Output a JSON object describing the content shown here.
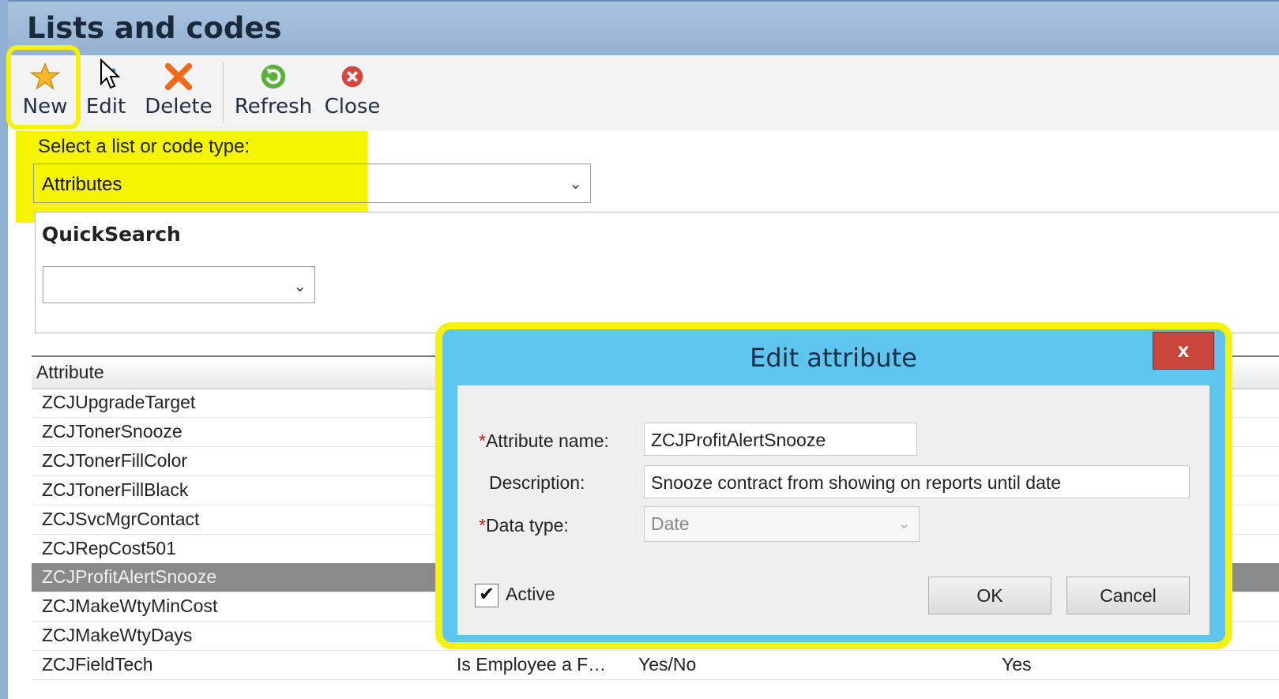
{
  "window": {
    "title": "Lists and codes"
  },
  "toolbar": {
    "new_label": "New",
    "edit_label": "Edit",
    "delete_label": "Delete",
    "refresh_label": "Refresh",
    "close_label": "Close"
  },
  "list_type": {
    "label": "Select a list or code type:",
    "value": "Attributes"
  },
  "quicksearch": {
    "label": "QuickSearch",
    "value": ""
  },
  "grid": {
    "column_attribute": "Attribute",
    "rows": [
      {
        "attribute": "ZCJUpgradeTarget"
      },
      {
        "attribute": "ZCJTonerSnooze"
      },
      {
        "attribute": "ZCJTonerFillColor"
      },
      {
        "attribute": "ZCJTonerFillBlack"
      },
      {
        "attribute": "ZCJSvcMgrContact"
      },
      {
        "attribute": "ZCJRepCost501"
      },
      {
        "attribute": "ZCJProfitAlertSnooze",
        "selected": true
      },
      {
        "attribute": "ZCJMakeWtyMinCost"
      },
      {
        "attribute": "ZCJMakeWtyDays"
      },
      {
        "attribute": "ZCJFieldTech",
        "description": "Is Employee a F…",
        "data_type": "Yes/No",
        "active": "Yes"
      }
    ]
  },
  "dialog": {
    "title": "Edit attribute",
    "close_glyph": "x",
    "required_mark": "*",
    "name_label": "Attribute name:",
    "name_value": "ZCJProfitAlertSnooze",
    "description_label": "Description:",
    "description_value": "Snooze contract from showing on reports until date",
    "datatype_label": "Data type:",
    "datatype_value": "Date",
    "active_label": "Active",
    "active_checked": true,
    "ok_label": "OK",
    "cancel_label": "Cancel"
  },
  "colors": {
    "highlight": "#f5f10a",
    "dialog_frame": "#5ec6ee",
    "title_bar": "#a9c3de",
    "close_button": "#c9463d",
    "required": "#c41d1d"
  },
  "icons": {
    "new": "star-icon",
    "edit": "cursor-icon",
    "delete": "x-icon",
    "refresh": "refresh-icon",
    "close": "close-circle-icon"
  }
}
